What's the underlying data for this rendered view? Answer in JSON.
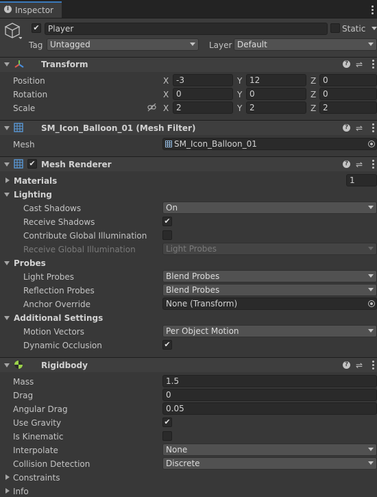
{
  "window": {
    "tab_title": "Inspector"
  },
  "gameobject": {
    "active": true,
    "name": "Player",
    "static_label": "Static",
    "static": false,
    "tag_label": "Tag",
    "tag": "Untagged",
    "layer_label": "Layer",
    "layer": "Default"
  },
  "transform": {
    "title": "Transform",
    "rows": [
      {
        "label": "Position",
        "x": "-3",
        "y": "12",
        "z": "0"
      },
      {
        "label": "Rotation",
        "x": "0",
        "y": "0",
        "z": "0"
      },
      {
        "label": "Scale",
        "x": "2",
        "y": "2",
        "z": "2"
      }
    ],
    "axes": {
      "x": "X",
      "y": "Y",
      "z": "Z"
    }
  },
  "mesh_filter": {
    "title": "SM_Icon_Balloon_01 (Mesh Filter)",
    "mesh_label": "Mesh",
    "mesh_value": "SM_Icon_Balloon_01"
  },
  "mesh_renderer": {
    "title": "Mesh Renderer",
    "enabled": true,
    "materials_label": "Materials",
    "materials_count": "1",
    "lighting_label": "Lighting",
    "cast_shadows_label": "Cast Shadows",
    "cast_shadows": "On",
    "receive_shadows_label": "Receive Shadows",
    "receive_shadows": true,
    "contribute_gi_label": "Contribute Global Illumination",
    "contribute_gi": false,
    "receive_gi_label": "Receive Global Illumination",
    "receive_gi": "Light Probes",
    "probes_label": "Probes",
    "light_probes_label": "Light Probes",
    "light_probes": "Blend Probes",
    "reflection_probes_label": "Reflection Probes",
    "reflection_probes": "Blend Probes",
    "anchor_override_label": "Anchor Override",
    "anchor_override": "None (Transform)",
    "additional_label": "Additional Settings",
    "motion_vectors_label": "Motion Vectors",
    "motion_vectors": "Per Object Motion",
    "dynamic_occlusion_label": "Dynamic Occlusion",
    "dynamic_occlusion": true
  },
  "rigidbody": {
    "title": "Rigidbody",
    "mass_label": "Mass",
    "mass": "1.5",
    "drag_label": "Drag",
    "drag": "0",
    "angular_drag_label": "Angular Drag",
    "angular_drag": "0.05",
    "use_gravity_label": "Use Gravity",
    "use_gravity": true,
    "is_kinematic_label": "Is Kinematic",
    "is_kinematic": false,
    "interpolate_label": "Interpolate",
    "interpolate": "None",
    "collision_label": "Collision Detection",
    "collision": "Discrete",
    "constraints_label": "Constraints",
    "info_label": "Info"
  },
  "colors": {
    "background": "#383838",
    "header": "#3e3e3e",
    "field": "#2a2a2a",
    "dropdown": "#515151"
  },
  "icons": [
    "info-circle-icon",
    "cube-icon",
    "transform-axes-icon",
    "grid-icon",
    "help-icon",
    "preset-sliders-icon",
    "kebab-menu-icon",
    "lock-link-icon",
    "object-picker-icon",
    "rigidbody-icon"
  ]
}
